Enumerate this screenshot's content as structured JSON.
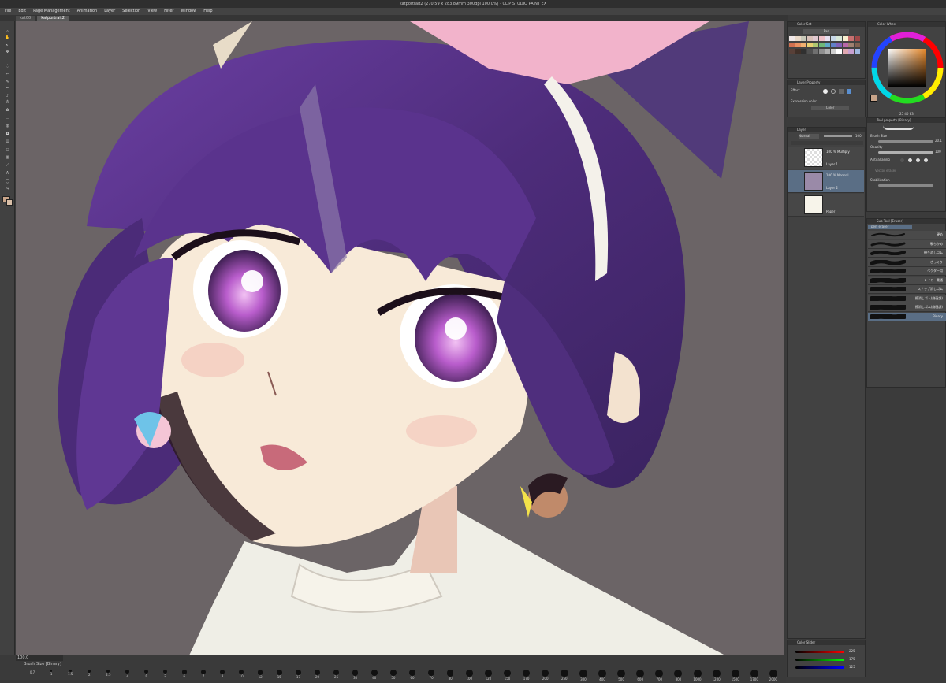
{
  "app": {
    "title": "katportrait2 (270.59 x 283.89mm 300dpi 100.0%) - CLIP STUDIO PAINT EX"
  },
  "menu": [
    "File",
    "Edit",
    "Page Management",
    "Animation",
    "Layer",
    "Selection",
    "View",
    "Filter",
    "Window",
    "Help"
  ],
  "tabs": [
    {
      "label": "kat00"
    },
    {
      "label": "katportrait2"
    }
  ],
  "panels": {
    "color_set": {
      "title": "Color Set",
      "set_name": "Pas"
    },
    "color_wheel": {
      "title": "Color Wheel",
      "values": [
        "25",
        "40",
        "83"
      ]
    },
    "layer_property": {
      "title": "Layer Property",
      "effect_label": "Effect",
      "expression_label": "Expression color",
      "expression_value": "Color"
    },
    "layer": {
      "title": "Layer",
      "blend_mode": "Normal",
      "opacity": "100",
      "layers": [
        {
          "line1": "100 % Multiply",
          "line2": "Layer 1"
        },
        {
          "line1": "100 % Normal",
          "line2": "Layer 2"
        },
        {
          "line1": "",
          "line2": "Paper"
        }
      ]
    },
    "tool_property": {
      "title": "Tool property [Binary]",
      "brush_size_label": "Brush Size",
      "brush_size_value": "20.1",
      "opacity_label": "Opacity",
      "opacity_value": "100",
      "anti_aliasing_label": "Anti-aliasing",
      "vector_eraser_label": "Vector eraser",
      "stabilization_label": "Stabilization"
    },
    "sub_tool": {
      "title": "Sub Tool [Eraser]",
      "group": "pen_eraser",
      "items": [
        {
          "label": "硬め"
        },
        {
          "label": "軟らかめ"
        },
        {
          "label": "練り消しゴム"
        },
        {
          "label": "ざっくり"
        },
        {
          "label": "ベクター用"
        },
        {
          "label": "レイヤー貫通"
        },
        {
          "label": "スナップ消しゴム"
        },
        {
          "label": "擦消しゴム(劇画調)"
        },
        {
          "label": "擦消しゴム(劇画調)"
        },
        {
          "label": "Binary"
        }
      ]
    },
    "color_slider": {
      "title": "Color Slider",
      "values": [
        "225",
        "175",
        "125"
      ]
    }
  },
  "bottom": {
    "zoom": "100.0",
    "brush_size_title": "Brush Size [Binary]",
    "sizes": [
      "0.7",
      "1",
      "1.5",
      "2",
      "2.5",
      "3",
      "4",
      "5",
      "6",
      "7",
      "8",
      "10",
      "12",
      "15",
      "17",
      "20",
      "25",
      "30",
      "40",
      "50",
      "60",
      "70",
      "80",
      "100",
      "120",
      "150",
      "170",
      "200",
      "250",
      "300",
      "400",
      "500",
      "600",
      "700",
      "800",
      "1000",
      "1200",
      "1500",
      "1700",
      "2000"
    ]
  },
  "colors": {
    "canvas_bg": "#6c6567",
    "hair": "#5b3590",
    "skin": "#f6e8d6",
    "eye": "#b85fc9",
    "highlight": "#5a6e85"
  }
}
